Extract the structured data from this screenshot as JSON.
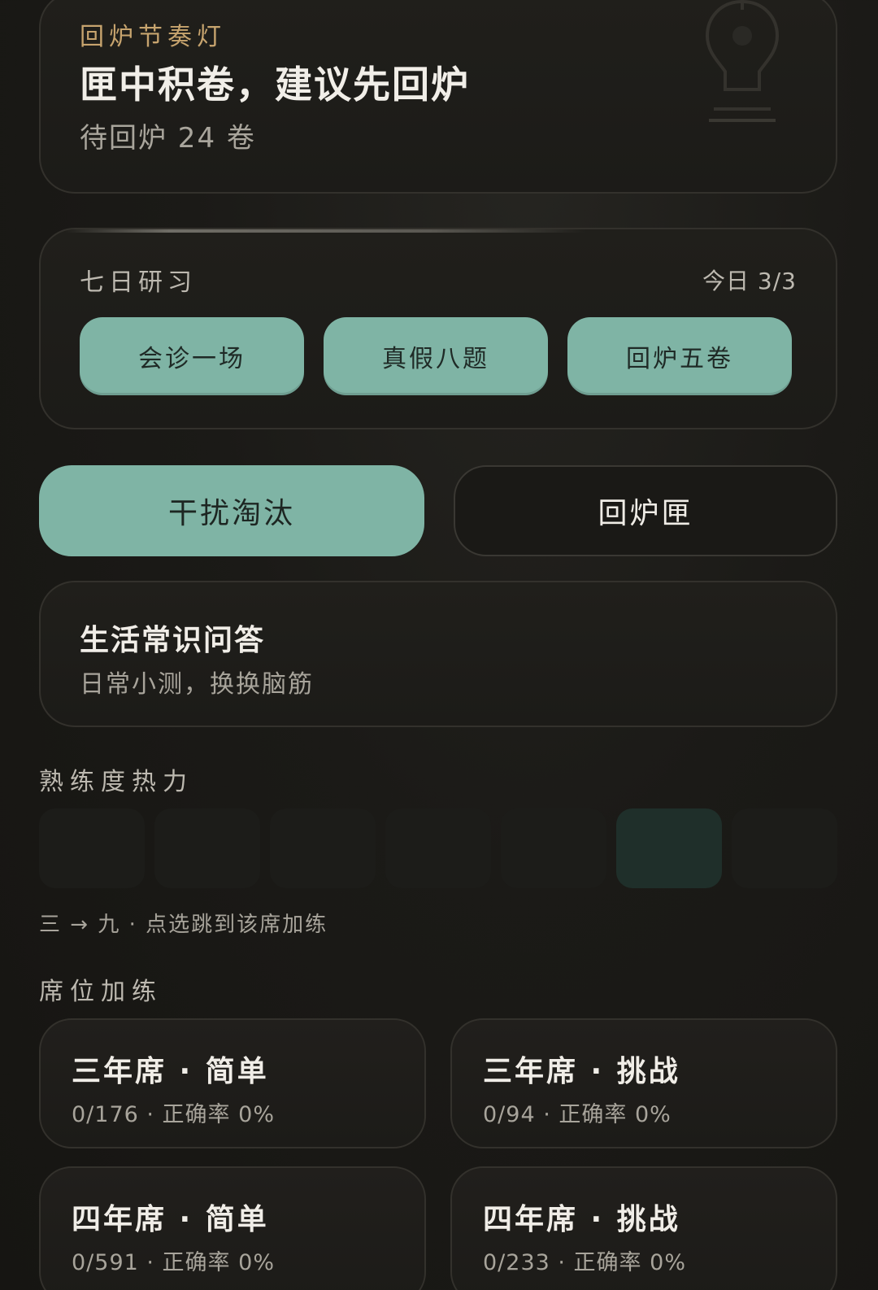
{
  "rhythm_card": {
    "eyebrow": "回炉节奏灯",
    "title": "匣中积卷，建议先回炉",
    "subtitle": "待回炉 24 卷",
    "icon": "lightbulb-icon"
  },
  "seven_day": {
    "label": "七日研习",
    "today": "今日 3/3",
    "tasks": [
      "会诊一场",
      "真假八题",
      "回炉五卷"
    ]
  },
  "actions": {
    "primary": "干扰淘汰",
    "secondary": "回炉匣"
  },
  "quiz_card": {
    "title": "生活常识问答",
    "subtitle": "日常小测，换换脑筋"
  },
  "heat": {
    "title": "熟练度热力",
    "hint": "三 → 九 · 点选跳到该席加练",
    "levels": [
      0,
      0,
      0,
      0,
      0,
      1,
      0
    ],
    "colors": {
      "empty": "#1c1c19",
      "active": "#1f2f2a"
    }
  },
  "seats": {
    "title": "席位加练",
    "items": [
      {
        "title": "三年席 · 简单",
        "stats": "0/176 · 正确率 0%"
      },
      {
        "title": "三年席 · 挑战",
        "stats": "0/94 · 正确率 0%"
      },
      {
        "title": "四年席 · 简单",
        "stats": "0/591 · 正确率 0%"
      },
      {
        "title": "四年席 · 挑战",
        "stats": "0/233 · 正确率 0%"
      }
    ]
  },
  "accent": "#7fb4a5"
}
